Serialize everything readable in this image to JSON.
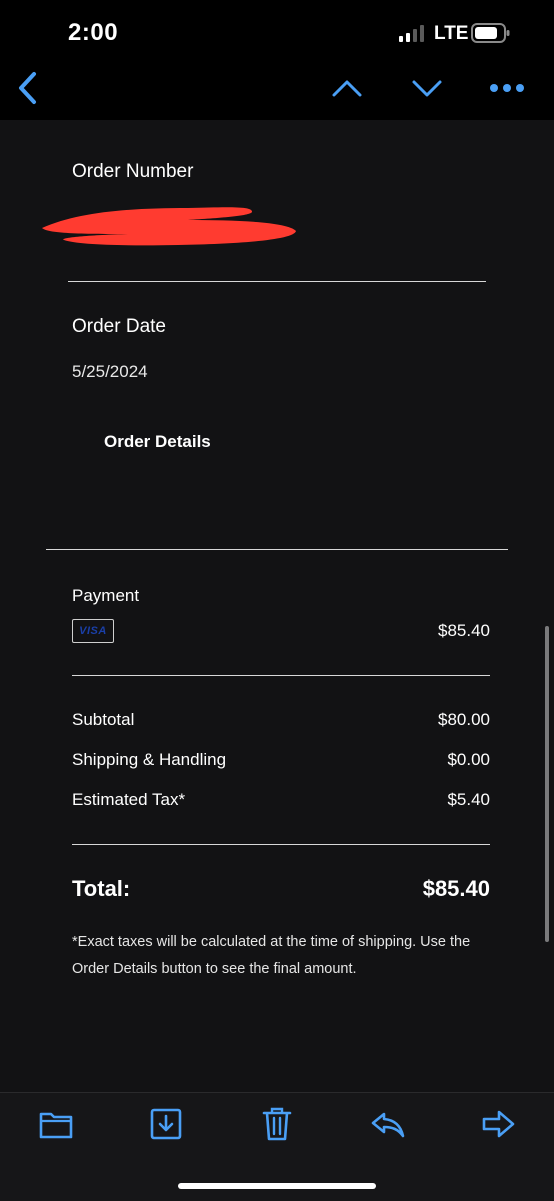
{
  "status_bar": {
    "time": "2:00",
    "network": "LTE",
    "icons": [
      "signal-bars-icon",
      "battery-icon"
    ]
  },
  "toolbar": {
    "icons": [
      "back-chevron-icon",
      "chevron-up-icon",
      "chevron-down-icon",
      "more-dots-icon"
    ],
    "accent_color": "#4a9ff5"
  },
  "order": {
    "number_label": "Order Number",
    "date_label": "Order Date",
    "date_value": "5/25/2024",
    "details_button": "Order Details"
  },
  "payment": {
    "label": "Payment",
    "card_brand": "VISA",
    "amount": "$85.40"
  },
  "summary": {
    "rows": [
      {
        "label": "Subtotal",
        "value": "$80.00"
      },
      {
        "label": "Shipping & Handling",
        "value": "$0.00"
      },
      {
        "label": "Estimated Tax*",
        "value": "$5.40"
      }
    ],
    "total_label": "Total:",
    "total_value": "$85.40",
    "note": "*Exact taxes will be calculated at the time of shipping. Use the Order Details button to see the final amount."
  },
  "bottom_toolbar": {
    "icons": [
      "folder-icon",
      "archive-icon",
      "trash-icon",
      "reply-icon",
      "forward-icon"
    ]
  },
  "colors": {
    "background": "#121214",
    "redaction": "#ff3b30"
  }
}
